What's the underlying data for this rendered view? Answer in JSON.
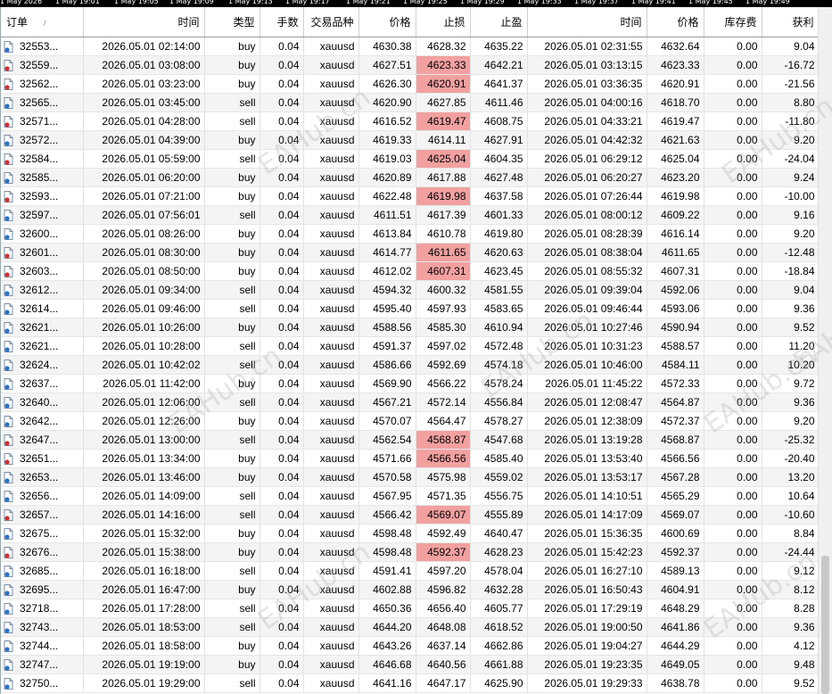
{
  "time_axis": [
    "1 May 2026",
    "1 May 19:01",
    "1 May 19:05",
    "1 May 19:09",
    "1 May 19:13",
    "1 May 19:17",
    "1 May 19:21",
    "1 May 19:25",
    "1 May 19:29",
    "1 May 19:33",
    "1 May 19:37",
    "1 May 19:41",
    "1 May 19:45",
    "1 May 19:49"
  ],
  "headers": {
    "order": "订单",
    "open_time": "时间",
    "type": "类型",
    "lots": "手数",
    "symbol": "交易品种",
    "open_price": "价格",
    "sl": "止损",
    "tp": "止盈",
    "close_time": "时间",
    "close_price": "价格",
    "swap": "库存费",
    "profit": "获利"
  },
  "sort_indicator": "/",
  "highlight_color": "#f2a0a0",
  "watermark": "EAHub.cn",
  "rows": [
    {
      "order": "32553...",
      "open_time": "2026.05.01 02:14:00",
      "type": "buy",
      "lots": "0.04",
      "symbol": "xauusd",
      "open_price": "4630.38",
      "sl": "4628.32",
      "tp": "4635.22",
      "close_time": "2026.05.01 02:31:55",
      "close_price": "4632.64",
      "swap": "0.00",
      "profit": "9.04",
      "sl_hit": false
    },
    {
      "order": "32559...",
      "open_time": "2026.05.01 03:08:00",
      "type": "buy",
      "lots": "0.04",
      "symbol": "xauusd",
      "open_price": "4627.51",
      "sl": "4623.33",
      "tp": "4642.21",
      "close_time": "2026.05.01 03:13:15",
      "close_price": "4623.33",
      "swap": "0.00",
      "profit": "-16.72",
      "sl_hit": true
    },
    {
      "order": "32562...",
      "open_time": "2026.05.01 03:23:00",
      "type": "buy",
      "lots": "0.04",
      "symbol": "xauusd",
      "open_price": "4626.30",
      "sl": "4620.91",
      "tp": "4641.37",
      "close_time": "2026.05.01 03:36:35",
      "close_price": "4620.91",
      "swap": "0.00",
      "profit": "-21.56",
      "sl_hit": true
    },
    {
      "order": "32565...",
      "open_time": "2026.05.01 03:45:00",
      "type": "sell",
      "lots": "0.04",
      "symbol": "xauusd",
      "open_price": "4620.90",
      "sl": "4627.85",
      "tp": "4611.46",
      "close_time": "2026.05.01 04:00:16",
      "close_price": "4618.70",
      "swap": "0.00",
      "profit": "8.80",
      "sl_hit": false
    },
    {
      "order": "32571...",
      "open_time": "2026.05.01 04:28:00",
      "type": "sell",
      "lots": "0.04",
      "symbol": "xauusd",
      "open_price": "4616.52",
      "sl": "4619.47",
      "tp": "4608.75",
      "close_time": "2026.05.01 04:33:21",
      "close_price": "4619.47",
      "swap": "0.00",
      "profit": "-11.80",
      "sl_hit": true
    },
    {
      "order": "32572...",
      "open_time": "2026.05.01 04:39:00",
      "type": "buy",
      "lots": "0.04",
      "symbol": "xauusd",
      "open_price": "4619.33",
      "sl": "4614.11",
      "tp": "4627.91",
      "close_time": "2026.05.01 04:42:32",
      "close_price": "4621.63",
      "swap": "0.00",
      "profit": "9.20",
      "sl_hit": false
    },
    {
      "order": "32584...",
      "open_time": "2026.05.01 05:59:00",
      "type": "sell",
      "lots": "0.04",
      "symbol": "xauusd",
      "open_price": "4619.03",
      "sl": "4625.04",
      "tp": "4604.35",
      "close_time": "2026.05.01 06:29:12",
      "close_price": "4625.04",
      "swap": "0.00",
      "profit": "-24.04",
      "sl_hit": true
    },
    {
      "order": "32585...",
      "open_time": "2026.05.01 06:20:00",
      "type": "buy",
      "lots": "0.04",
      "symbol": "xauusd",
      "open_price": "4620.89",
      "sl": "4617.88",
      "tp": "4627.48",
      "close_time": "2026.05.01 06:20:27",
      "close_price": "4623.20",
      "swap": "0.00",
      "profit": "9.24",
      "sl_hit": false
    },
    {
      "order": "32593...",
      "open_time": "2026.05.01 07:21:00",
      "type": "buy",
      "lots": "0.04",
      "symbol": "xauusd",
      "open_price": "4622.48",
      "sl": "4619.98",
      "tp": "4637.58",
      "close_time": "2026.05.01 07:26:44",
      "close_price": "4619.98",
      "swap": "0.00",
      "profit": "-10.00",
      "sl_hit": true
    },
    {
      "order": "32597...",
      "open_time": "2026.05.01 07:56:01",
      "type": "sell",
      "lots": "0.04",
      "symbol": "xauusd",
      "open_price": "4611.51",
      "sl": "4617.39",
      "tp": "4601.33",
      "close_time": "2026.05.01 08:00:12",
      "close_price": "4609.22",
      "swap": "0.00",
      "profit": "9.16",
      "sl_hit": false
    },
    {
      "order": "32600...",
      "open_time": "2026.05.01 08:26:00",
      "type": "buy",
      "lots": "0.04",
      "symbol": "xauusd",
      "open_price": "4613.84",
      "sl": "4610.78",
      "tp": "4619.80",
      "close_time": "2026.05.01 08:28:39",
      "close_price": "4616.14",
      "swap": "0.00",
      "profit": "9.20",
      "sl_hit": false
    },
    {
      "order": "32601...",
      "open_time": "2026.05.01 08:30:00",
      "type": "buy",
      "lots": "0.04",
      "symbol": "xauusd",
      "open_price": "4614.77",
      "sl": "4611.65",
      "tp": "4620.63",
      "close_time": "2026.05.01 08:38:04",
      "close_price": "4611.65",
      "swap": "0.00",
      "profit": "-12.48",
      "sl_hit": true
    },
    {
      "order": "32603...",
      "open_time": "2026.05.01 08:50:00",
      "type": "buy",
      "lots": "0.04",
      "symbol": "xauusd",
      "open_price": "4612.02",
      "sl": "4607.31",
      "tp": "4623.45",
      "close_time": "2026.05.01 08:55:32",
      "close_price": "4607.31",
      "swap": "0.00",
      "profit": "-18.84",
      "sl_hit": true
    },
    {
      "order": "32612...",
      "open_time": "2026.05.01 09:34:00",
      "type": "sell",
      "lots": "0.04",
      "symbol": "xauusd",
      "open_price": "4594.32",
      "sl": "4600.32",
      "tp": "4581.55",
      "close_time": "2026.05.01 09:39:04",
      "close_price": "4592.06",
      "swap": "0.00",
      "profit": "9.04",
      "sl_hit": false
    },
    {
      "order": "32614...",
      "open_time": "2026.05.01 09:46:00",
      "type": "sell",
      "lots": "0.04",
      "symbol": "xauusd",
      "open_price": "4595.40",
      "sl": "4597.93",
      "tp": "4583.65",
      "close_time": "2026.05.01 09:46:44",
      "close_price": "4593.06",
      "swap": "0.00",
      "profit": "9.36",
      "sl_hit": false
    },
    {
      "order": "32621...",
      "open_time": "2026.05.01 10:26:00",
      "type": "buy",
      "lots": "0.04",
      "symbol": "xauusd",
      "open_price": "4588.56",
      "sl": "4585.30",
      "tp": "4610.94",
      "close_time": "2026.05.01 10:27:46",
      "close_price": "4590.94",
      "swap": "0.00",
      "profit": "9.52",
      "sl_hit": false
    },
    {
      "order": "32621...",
      "open_time": "2026.05.01 10:28:00",
      "type": "sell",
      "lots": "0.04",
      "symbol": "xauusd",
      "open_price": "4591.37",
      "sl": "4597.02",
      "tp": "4572.48",
      "close_time": "2026.05.01 10:31:23",
      "close_price": "4588.57",
      "swap": "0.00",
      "profit": "11.20",
      "sl_hit": false
    },
    {
      "order": "32624...",
      "open_time": "2026.05.01 10:42:02",
      "type": "sell",
      "lots": "0.04",
      "symbol": "xauusd",
      "open_price": "4586.66",
      "sl": "4592.69",
      "tp": "4574.18",
      "close_time": "2026.05.01 10:46:00",
      "close_price": "4584.11",
      "swap": "0.00",
      "profit": "10.20",
      "sl_hit": false
    },
    {
      "order": "32637...",
      "open_time": "2026.05.01 11:42:00",
      "type": "buy",
      "lots": "0.04",
      "symbol": "xauusd",
      "open_price": "4569.90",
      "sl": "4566.22",
      "tp": "4578.24",
      "close_time": "2026.05.01 11:45:22",
      "close_price": "4572.33",
      "swap": "0.00",
      "profit": "9.72",
      "sl_hit": false
    },
    {
      "order": "32640...",
      "open_time": "2026.05.01 12:06:00",
      "type": "sell",
      "lots": "0.04",
      "symbol": "xauusd",
      "open_price": "4567.21",
      "sl": "4572.14",
      "tp": "4556.84",
      "close_time": "2026.05.01 12:08:47",
      "close_price": "4564.87",
      "swap": "0.00",
      "profit": "9.36",
      "sl_hit": false
    },
    {
      "order": "32642...",
      "open_time": "2026.05.01 12:26:00",
      "type": "buy",
      "lots": "0.04",
      "symbol": "xauusd",
      "open_price": "4570.07",
      "sl": "4564.47",
      "tp": "4578.27",
      "close_time": "2026.05.01 12:38:09",
      "close_price": "4572.37",
      "swap": "0.00",
      "profit": "9.20",
      "sl_hit": false
    },
    {
      "order": "32647...",
      "open_time": "2026.05.01 13:00:00",
      "type": "sell",
      "lots": "0.04",
      "symbol": "xauusd",
      "open_price": "4562.54",
      "sl": "4568.87",
      "tp": "4547.68",
      "close_time": "2026.05.01 13:19:28",
      "close_price": "4568.87",
      "swap": "0.00",
      "profit": "-25.32",
      "sl_hit": true
    },
    {
      "order": "32651...",
      "open_time": "2026.05.01 13:34:00",
      "type": "buy",
      "lots": "0.04",
      "symbol": "xauusd",
      "open_price": "4571.66",
      "sl": "4566.56",
      "tp": "4585.40",
      "close_time": "2026.05.01 13:53:40",
      "close_price": "4566.56",
      "swap": "0.00",
      "profit": "-20.40",
      "sl_hit": true
    },
    {
      "order": "32653...",
      "open_time": "2026.05.01 13:46:00",
      "type": "buy",
      "lots": "0.04",
      "symbol": "xauusd",
      "open_price": "4570.58",
      "sl": "4575.98",
      "tp": "4559.02",
      "close_time": "2026.05.01 13:53:17",
      "close_price": "4567.28",
      "swap": "0.00",
      "profit": "13.20",
      "sl_hit": false
    },
    {
      "order": "32656...",
      "open_time": "2026.05.01 14:09:00",
      "type": "sell",
      "lots": "0.04",
      "symbol": "xauusd",
      "open_price": "4567.95",
      "sl": "4571.35",
      "tp": "4556.75",
      "close_time": "2026.05.01 14:10:51",
      "close_price": "4565.29",
      "swap": "0.00",
      "profit": "10.64",
      "sl_hit": false
    },
    {
      "order": "32657...",
      "open_time": "2026.05.01 14:16:00",
      "type": "sell",
      "lots": "0.04",
      "symbol": "xauusd",
      "open_price": "4566.42",
      "sl": "4569.07",
      "tp": "4555.89",
      "close_time": "2026.05.01 14:17:09",
      "close_price": "4569.07",
      "swap": "0.00",
      "profit": "-10.60",
      "sl_hit": true
    },
    {
      "order": "32675...",
      "open_time": "2026.05.01 15:32:00",
      "type": "buy",
      "lots": "0.04",
      "symbol": "xauusd",
      "open_price": "4598.48",
      "sl": "4592.49",
      "tp": "4640.47",
      "close_time": "2026.05.01 15:36:35",
      "close_price": "4600.69",
      "swap": "0.00",
      "profit": "8.84",
      "sl_hit": false
    },
    {
      "order": "32676...",
      "open_time": "2026.05.01 15:38:00",
      "type": "buy",
      "lots": "0.04",
      "symbol": "xauusd",
      "open_price": "4598.48",
      "sl": "4592.37",
      "tp": "4628.23",
      "close_time": "2026.05.01 15:42:23",
      "close_price": "4592.37",
      "swap": "0.00",
      "profit": "-24.44",
      "sl_hit": true
    },
    {
      "order": "32685...",
      "open_time": "2026.05.01 16:18:00",
      "type": "sell",
      "lots": "0.04",
      "symbol": "xauusd",
      "open_price": "4591.41",
      "sl": "4597.20",
      "tp": "4578.04",
      "close_time": "2026.05.01 16:27:10",
      "close_price": "4589.13",
      "swap": "0.00",
      "profit": "9.12",
      "sl_hit": false
    },
    {
      "order": "32695...",
      "open_time": "2026.05.01 16:47:00",
      "type": "buy",
      "lots": "0.04",
      "symbol": "xauusd",
      "open_price": "4602.88",
      "sl": "4596.82",
      "tp": "4632.28",
      "close_time": "2026.05.01 16:50:43",
      "close_price": "4604.91",
      "swap": "0.00",
      "profit": "8.12",
      "sl_hit": false
    },
    {
      "order": "32718...",
      "open_time": "2026.05.01 17:28:00",
      "type": "sell",
      "lots": "0.04",
      "symbol": "xauusd",
      "open_price": "4650.36",
      "sl": "4656.40",
      "tp": "4605.77",
      "close_time": "2026.05.01 17:29:19",
      "close_price": "4648.29",
      "swap": "0.00",
      "profit": "8.28",
      "sl_hit": false
    },
    {
      "order": "32743...",
      "open_time": "2026.05.01 18:53:00",
      "type": "sell",
      "lots": "0.04",
      "symbol": "xauusd",
      "open_price": "4644.20",
      "sl": "4648.08",
      "tp": "4618.52",
      "close_time": "2026.05.01 19:00:50",
      "close_price": "4641.86",
      "swap": "0.00",
      "profit": "9.36",
      "sl_hit": false
    },
    {
      "order": "32744...",
      "open_time": "2026.05.01 18:58:00",
      "type": "buy",
      "lots": "0.04",
      "symbol": "xauusd",
      "open_price": "4643.26",
      "sl": "4637.14",
      "tp": "4662.86",
      "close_time": "2026.05.01 19:04:27",
      "close_price": "4644.29",
      "swap": "0.00",
      "profit": "4.12",
      "sl_hit": false
    },
    {
      "order": "32747...",
      "open_time": "2026.05.01 19:19:00",
      "type": "buy",
      "lots": "0.04",
      "symbol": "xauusd",
      "open_price": "4646.68",
      "sl": "4640.56",
      "tp": "4661.88",
      "close_time": "2026.05.01 19:23:35",
      "close_price": "4649.05",
      "swap": "0.00",
      "profit": "9.48",
      "sl_hit": false
    },
    {
      "order": "32750...",
      "open_time": "2026.05.01 19:29:00",
      "type": "sell",
      "lots": "0.04",
      "symbol": "xauusd",
      "open_price": "4641.16",
      "sl": "4647.17",
      "tp": "4625.90",
      "close_time": "2026.05.01 19:29:33",
      "close_price": "4638.78",
      "swap": "0.00",
      "profit": "9.52",
      "sl_hit": false
    }
  ]
}
